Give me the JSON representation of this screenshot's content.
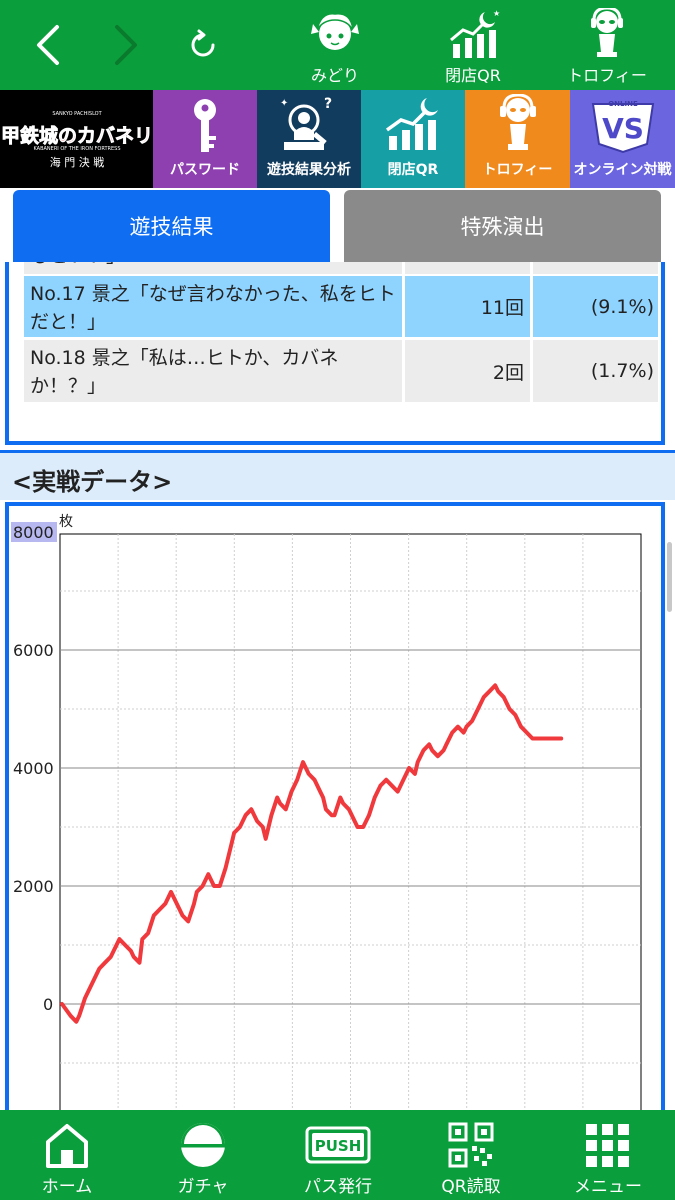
{
  "topnav": {
    "items": [
      {
        "label": "みどり",
        "icon": "character-icon"
      },
      {
        "label": "閉店QR",
        "icon": "closing-qr-icon"
      },
      {
        "label": "トロフィー",
        "icon": "trophy-icon"
      }
    ]
  },
  "banner": {
    "game_logo_text": "甲鉄城のカバネリ",
    "game_logo_sub": "海 門 決 戦",
    "tiles": [
      {
        "label": "パスワード",
        "icon": "key-icon",
        "color": "#8e3fb0"
      },
      {
        "label": "遊技結果分析",
        "icon": "analysis-icon",
        "color": "#123c5e"
      },
      {
        "label": "閉店QR",
        "icon": "closing-qr-icon",
        "color": "#16a0a6"
      },
      {
        "label": "トロフィー",
        "icon": "trophy-icon",
        "color": "#f08a1c"
      },
      {
        "label": "オンライン対戦",
        "icon": "online-vs-icon",
        "color": "#6b66e0"
      }
    ]
  },
  "tabs": {
    "active": "遊技結果",
    "items": [
      "遊技結果",
      "特殊演出"
    ]
  },
  "table": {
    "partial_row": "るといい」",
    "rows": [
      {
        "no": "No.17 景之「なぜ言わなかった、私をヒトだと！」",
        "count": "11回",
        "rate": "(9.1%)",
        "highlight": true
      },
      {
        "no": "No.18 景之「私は…ヒトか、カバネか！？」",
        "count": "2回",
        "rate": "(1.7%)",
        "highlight": false
      }
    ]
  },
  "section": {
    "title": "<実戦データ>"
  },
  "chart_data": {
    "type": "line",
    "ylabel": "枚",
    "yticks": [
      8000,
      6000,
      4000,
      2000,
      0
    ],
    "ylim": [
      -1800,
      8000
    ],
    "xlim": [
      0,
      100
    ],
    "grid": true,
    "line_color": "#f0393c",
    "series": [
      {
        "x": [
          0,
          3,
          5,
          6,
          8,
          11,
          13,
          15,
          17,
          20,
          22,
          24,
          25,
          27,
          28,
          30,
          32,
          34,
          36,
          38,
          40,
          42,
          44,
          46,
          47,
          49,
          51,
          53,
          55,
          57,
          59,
          60,
          62,
          64,
          66,
          68,
          70,
          71,
          73,
          75,
          76,
          78,
          80,
          82,
          84,
          86,
          88,
          90,
          91,
          92,
          94,
          95,
          97,
          98,
          100,
          101,
          103,
          105,
          107,
          109,
          111,
          113,
          115,
          117,
          119,
          121,
          123,
          124,
          126,
          128,
          129,
          131,
          133,
          134,
          136,
          138,
          140,
          141,
          143,
          145,
          147,
          149,
          151,
          152,
          154,
          156,
          158,
          160,
          162,
          164,
          166,
          168,
          170,
          172,
          174,
          176,
          177,
          179,
          181,
          183
        ],
        "y": [
          0,
          -200,
          -300,
          -200,
          100,
          400,
          600,
          700,
          800,
          1100,
          1000,
          900,
          800,
          700,
          1100,
          1200,
          1500,
          1600,
          1700,
          1900,
          1700,
          1500,
          1400,
          1700,
          1900,
          2000,
          2200,
          2000,
          2000,
          2300,
          2700,
          2900,
          3000,
          3200,
          3300,
          3100,
          3000,
          2800,
          3200,
          3500,
          3400,
          3300,
          3600,
          3800,
          4100,
          3900,
          3800,
          3600,
          3500,
          3300,
          3200,
          3200,
          3500,
          3400,
          3300,
          3200,
          3000,
          3000,
          3200,
          3500,
          3700,
          3800,
          3700,
          3600,
          3800,
          4000,
          3900,
          4100,
          4300,
          4400,
          4300,
          4200,
          4300,
          4400,
          4600,
          4700,
          4600,
          4700,
          4800,
          5000,
          5200,
          5300,
          5400,
          5300,
          5200,
          5000,
          4900,
          4700,
          4600,
          4500,
          4500,
          4500,
          4500,
          4500,
          4500,
          4500,
          4500,
          4500,
          4500,
          4500
        ]
      }
    ]
  },
  "bottomnav": {
    "items": [
      {
        "label": "ホーム",
        "icon": "home-icon"
      },
      {
        "label": "ガチャ",
        "icon": "gacha-icon"
      },
      {
        "label": "パス発行",
        "icon": "push-icon",
        "badge": "PUSH"
      },
      {
        "label": "QR読取",
        "icon": "qr-reader-icon"
      },
      {
        "label": "メニュー",
        "icon": "menu-grid-icon"
      }
    ]
  }
}
